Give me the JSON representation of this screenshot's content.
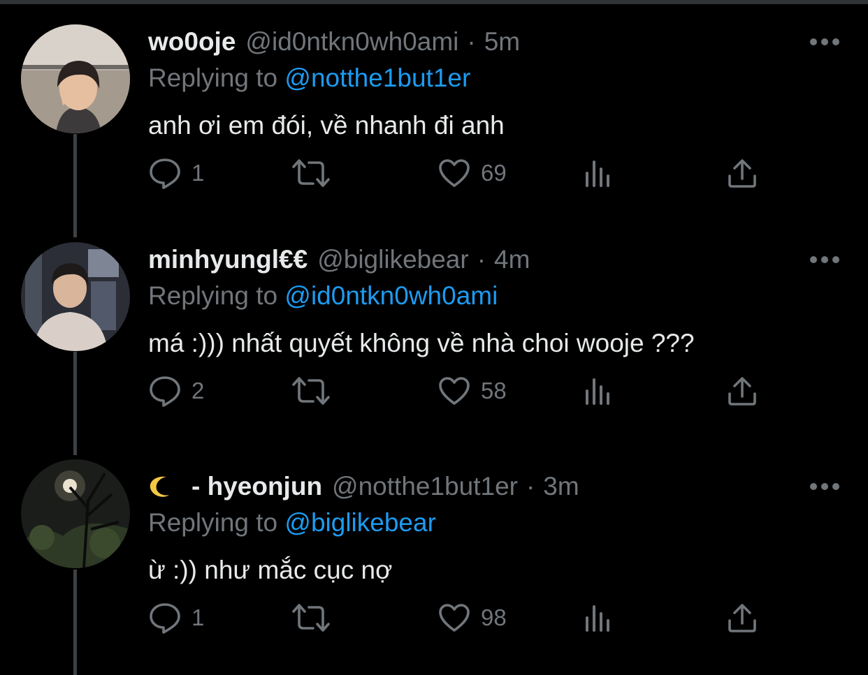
{
  "tweets": [
    {
      "name": "wo0oje",
      "has_moon": false,
      "handle": "@id0ntkn0wh0ami",
      "separator": "·",
      "time": "5m",
      "replying_label": "Replying to",
      "replying_to": "@notthe1but1er",
      "text": "anh ơi em đói, về nhanh đi anh",
      "reply_count": "1",
      "like_count": "69"
    },
    {
      "name": "minhyungl€€",
      "has_moon": false,
      "handle": "@biglikebear",
      "separator": "·",
      "time": "4m",
      "replying_label": "Replying to",
      "replying_to": "@id0ntkn0wh0ami",
      "text": "má :))) nhất quyết không về nhà choi wooje ???",
      "reply_count": "2",
      "like_count": "58"
    },
    {
      "name": "- hyeonjun",
      "has_moon": true,
      "handle": "@notthe1but1er",
      "separator": "·",
      "time": "3m",
      "replying_label": "Replying to",
      "replying_to": "@biglikebear",
      "text": "ừ :)) như mắc cục nợ",
      "reply_count": "1",
      "like_count": "98"
    }
  ],
  "icons": {
    "more": "more-dots-icon",
    "reply": "reply-bubble-icon",
    "retweet": "retweet-arrows-icon",
    "like": "heart-icon",
    "views": "views-bars-icon",
    "share": "share-upload-icon"
  },
  "colors": {
    "background": "#000000",
    "text_primary": "#e7e9ea",
    "text_secondary": "#71767b",
    "mention": "#1d9bf0",
    "thread_line": "#3e4144"
  }
}
